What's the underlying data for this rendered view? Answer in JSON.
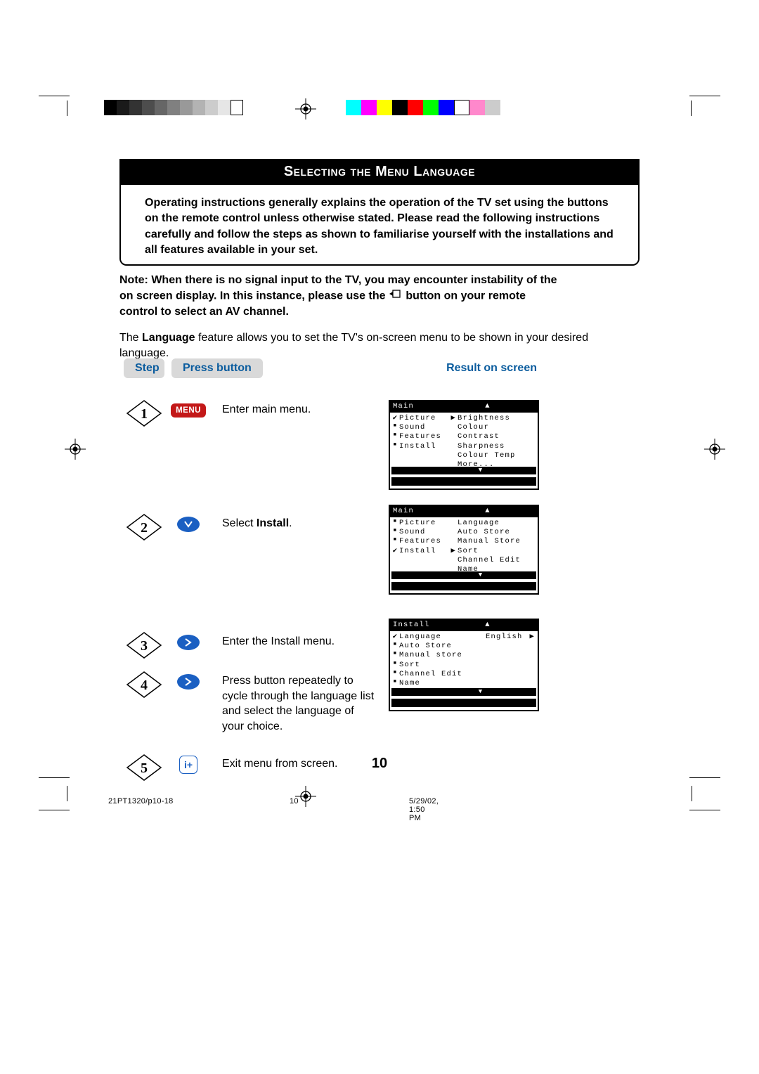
{
  "title": "Selecting the Menu Language",
  "intro_box": "Operating instructions generally explains the operation of the TV set using the buttons on the remote control unless otherwise stated. Please read the following instructions carefully and follow the steps as shown to familiarise yourself with the installations and all features available in your set.",
  "note_line1": "Note: When there is no signal input to the TV, you may encounter instability of the",
  "note_line2_a": "on screen display. In this instance, please use the",
  "note_line2_b": "button on your remote",
  "note_line3": "control to select an AV channel.",
  "lang_para_a": "The ",
  "lang_para_bold": "Language",
  "lang_para_b": " feature allows you to set the TV's on-screen menu to be shown in your desired language.",
  "hdr_step": "Step",
  "hdr_press": "Press button",
  "hdr_result": "Result on screen",
  "steps": {
    "s1": {
      "num": "1",
      "btn_label": "MENU",
      "desc": "Enter main menu."
    },
    "s2": {
      "num": "2",
      "desc_a": "Select ",
      "desc_bold": "Install",
      "desc_b": "."
    },
    "s3": {
      "num": "3",
      "desc": "Enter the Install menu."
    },
    "s4": {
      "num": "4",
      "desc": "Press button repeatedly to cycle through the language list and select the language of your choice."
    },
    "s5": {
      "num": "5",
      "desc": "Exit menu from screen."
    }
  },
  "screen1": {
    "header": "Main",
    "left": [
      {
        "mark": "✔",
        "label": "Picture",
        "arrow": "▶"
      },
      {
        "mark": "■",
        "label": "Sound"
      },
      {
        "mark": "■",
        "label": "Features"
      },
      {
        "mark": "■",
        "label": "Install"
      }
    ],
    "right": [
      "Brightness",
      "Colour",
      "Contrast",
      "Sharpness",
      "Colour Temp",
      "More..."
    ]
  },
  "screen2": {
    "header": "Main",
    "left": [
      {
        "mark": "■",
        "label": "Picture"
      },
      {
        "mark": "■",
        "label": "Sound"
      },
      {
        "mark": "■",
        "label": "Features"
      },
      {
        "mark": "✔",
        "label": "Install",
        "arrow": "▶"
      }
    ],
    "right": [
      "Language",
      "Auto Store",
      "Manual Store",
      "Sort",
      "Channel Edit",
      "Name"
    ]
  },
  "screen3": {
    "header": "Install",
    "left": [
      {
        "mark": "✔",
        "label": "Language",
        "value": "English",
        "arrow": "▶"
      },
      {
        "mark": "■",
        "label": "Auto Store"
      },
      {
        "mark": "■",
        "label": "Manual store"
      },
      {
        "mark": "■",
        "label": "Sort"
      },
      {
        "mark": "■",
        "label": "Channel Edit"
      },
      {
        "mark": "■",
        "label": "Name"
      }
    ]
  },
  "page_number": "10",
  "footer": {
    "doc_id": "21PT1320/p10-18",
    "page": "10",
    "datetime": "5/29/02, 1:50 PM"
  }
}
